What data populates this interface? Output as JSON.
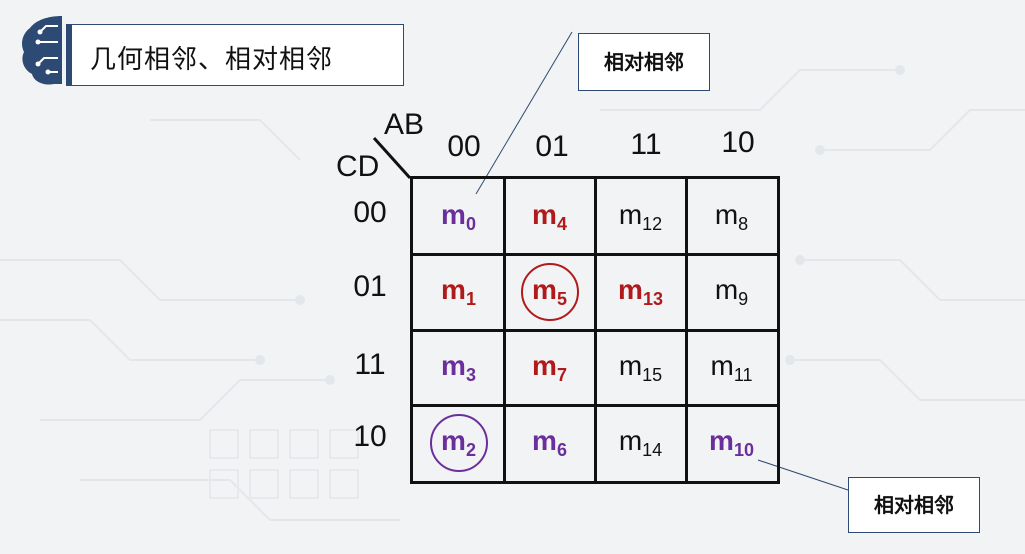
{
  "title": "几何相邻、相对相邻",
  "callouts": {
    "top": "相对相邻",
    "bottom": "相对相邻"
  },
  "kmap": {
    "var_ab": "AB",
    "var_cd": "CD",
    "col_headers": [
      "00",
      "01",
      "11",
      "10"
    ],
    "row_headers": [
      "00",
      "01",
      "11",
      "10"
    ],
    "cells": [
      [
        {
          "m": "m",
          "sub": "0",
          "style": "purple"
        },
        {
          "m": "m",
          "sub": "4",
          "style": "red"
        },
        {
          "m": "m",
          "sub": "12",
          "style": "plain"
        },
        {
          "m": "m",
          "sub": "8",
          "style": "plain"
        }
      ],
      [
        {
          "m": "m",
          "sub": "1",
          "style": "red"
        },
        {
          "m": "m",
          "sub": "5",
          "style": "red",
          "circled": true
        },
        {
          "m": "m",
          "sub": "13",
          "style": "red"
        },
        {
          "m": "m",
          "sub": "9",
          "style": "plain"
        }
      ],
      [
        {
          "m": "m",
          "sub": "3",
          "style": "purple"
        },
        {
          "m": "m",
          "sub": "7",
          "style": "red"
        },
        {
          "m": "m",
          "sub": "15",
          "style": "plain"
        },
        {
          "m": "m",
          "sub": "11",
          "style": "plain"
        }
      ],
      [
        {
          "m": "m",
          "sub": "2",
          "style": "purple",
          "circled": true
        },
        {
          "m": "m",
          "sub": "6",
          "style": "purple"
        },
        {
          "m": "m",
          "sub": "14",
          "style": "plain"
        },
        {
          "m": "m",
          "sub": "10",
          "style": "purple"
        }
      ]
    ]
  },
  "colors": {
    "red": "#b01a1a",
    "purple": "#6a2f9c",
    "accent": "#2c4a73"
  },
  "icons": {
    "logo": "brain-circuit-icon"
  }
}
